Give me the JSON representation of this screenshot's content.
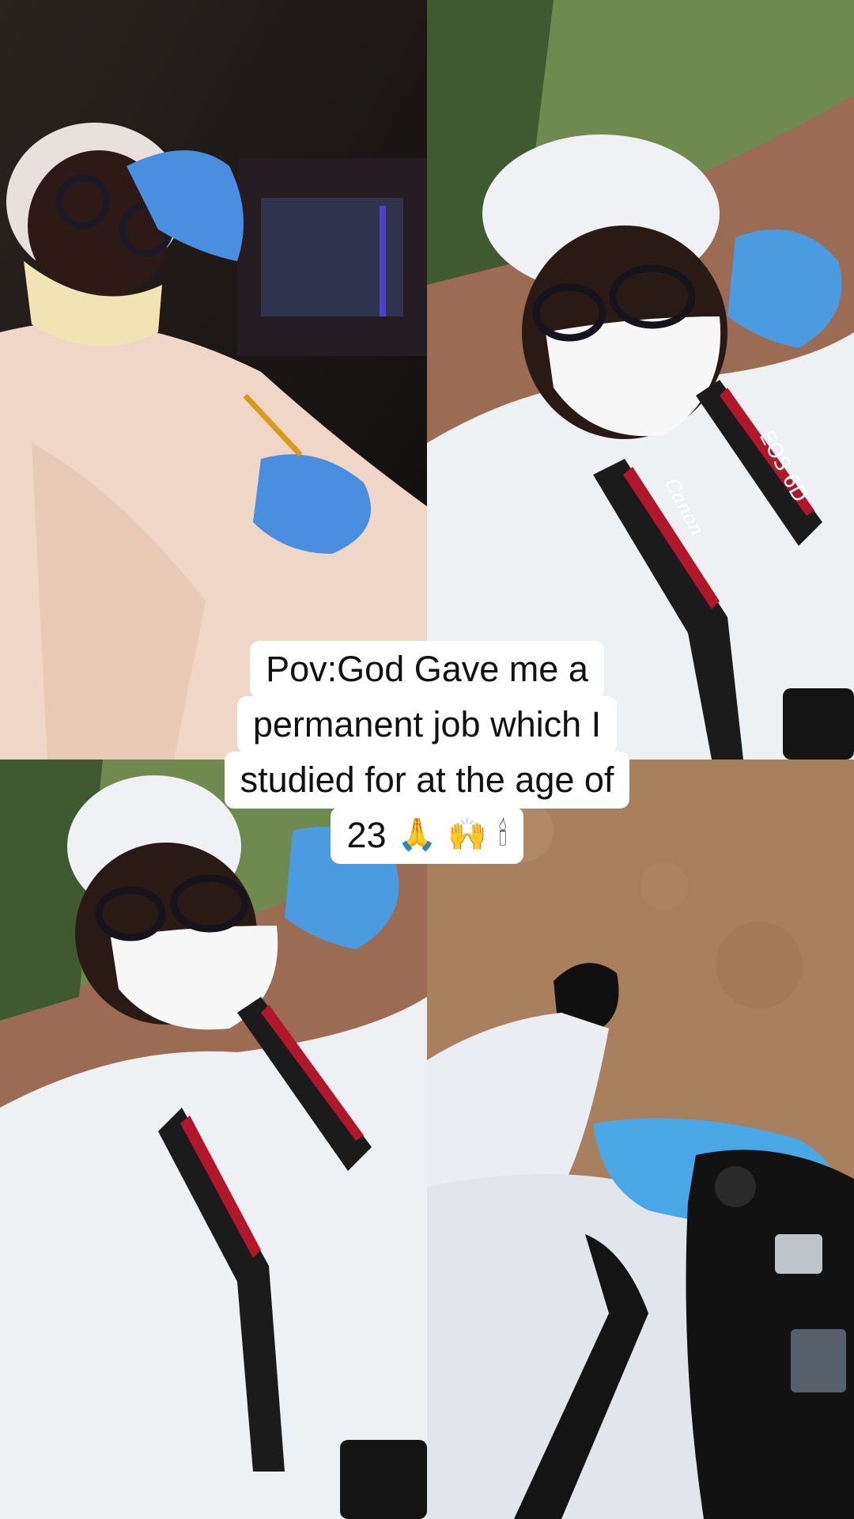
{
  "caption": {
    "line1": "Pov:God Gave me a",
    "line2": "permanent job which I",
    "line3": "studied for at the age of",
    "line4_text": "23",
    "emojis": [
      "🙏",
      "🙌",
      "🕯"
    ]
  },
  "strap_brand_text": "Canon",
  "strap_model_text": "EOS 6D",
  "colors": {
    "glove": "#4a9be0",
    "suit": "#eef1f4",
    "road": "#9b6b53",
    "grass": "#6f8a4e",
    "strap_red": "#b0172a",
    "caption_bg": "#ffffff"
  },
  "tiles": [
    {
      "id": "tl",
      "subject": "selfie-in-car-with-hairnet-and-mask"
    },
    {
      "id": "tr",
      "subject": "selfie-on-road-with-camera-strap"
    },
    {
      "id": "bl",
      "subject": "selfie-on-road-with-camera-strap"
    },
    {
      "id": "br",
      "subject": "top-down-shoe-and-camera"
    }
  ]
}
